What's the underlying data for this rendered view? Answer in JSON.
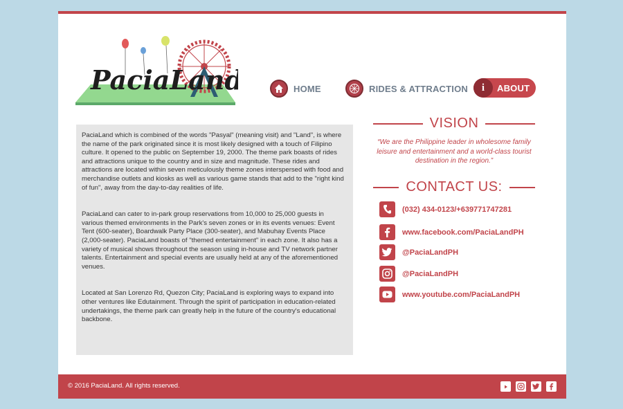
{
  "brand": {
    "logo_text": "PaciaLand",
    "color": "#c1444a",
    "nav_label_color": "#6f7d8c"
  },
  "nav": {
    "home": {
      "label": "HOME",
      "icon": "home-icon"
    },
    "rides": {
      "label": "RIDES & ATTRACTION",
      "icon": "ferris-wheel-icon"
    },
    "about": {
      "label": "ABOUT",
      "icon": "info-icon",
      "icon_glyph": "i"
    }
  },
  "about": {
    "paragraphs": [
      "PaciaLand which is combined of the words \"Pasyal\" (meaning visit) and \"Land\", is where the name of the park originated since it is most likely designed with a touch of Filipino culture. It opened to the public on September 19, 2000. The theme park boasts of rides and attractions unique to the country and in size and magnitude. These rides and attractions are located within seven meticulously theme zones interspersed with food and merchandise outlets and kiosks as well as various game stands that add to the \"right kind of fun\", away from the day-to-day realities of life.",
      "PaciaLand can cater to in-park group reservations from 10,000 to 25,000 guests in various themed environments in the Park's seven zones or in its events venues: Event Tent (600-seater), Boardwalk Party Place (300-seater), and Mabuhay Events Place (2,000-seater). PaciaLand boasts of \"themed entertainment\" in each zone. It also has a variety of musical shows throughout the season using in-house and TV network partner talents. Entertainment and special events are usually held at any of the aforementioned venues.",
      "Located at San Lorenzo Rd, Quezon City; PaciaLand is exploring ways to expand into other ventures like Edutainment. Through the spirit of participation in education-related undertakings, the theme park can greatly help in the future of the country's educational backbone."
    ]
  },
  "vision": {
    "heading": "VISION",
    "text": "“We are the Philippine leader in wholesome family leisure and entertainment and a world-class tourist destination in the region.”"
  },
  "contact": {
    "heading": "CONTACT US:",
    "items": [
      {
        "icon": "phone-icon",
        "text": "(032) 434-0123/+639771747281"
      },
      {
        "icon": "facebook-icon",
        "text": "www.facebook.com/PaciaLandPH"
      },
      {
        "icon": "twitter-icon",
        "text": "@PaciaLandPH"
      },
      {
        "icon": "instagram-icon",
        "text": "@PaciaLandPH"
      },
      {
        "icon": "youtube-icon",
        "text": "www.youtube.com/PaciaLandPH"
      }
    ]
  },
  "footer": {
    "copyright": "© 2016 PaciaLand. All rights reserved.",
    "social_icons": [
      "youtube-icon",
      "instagram-icon",
      "twitter-icon",
      "facebook-icon"
    ]
  }
}
